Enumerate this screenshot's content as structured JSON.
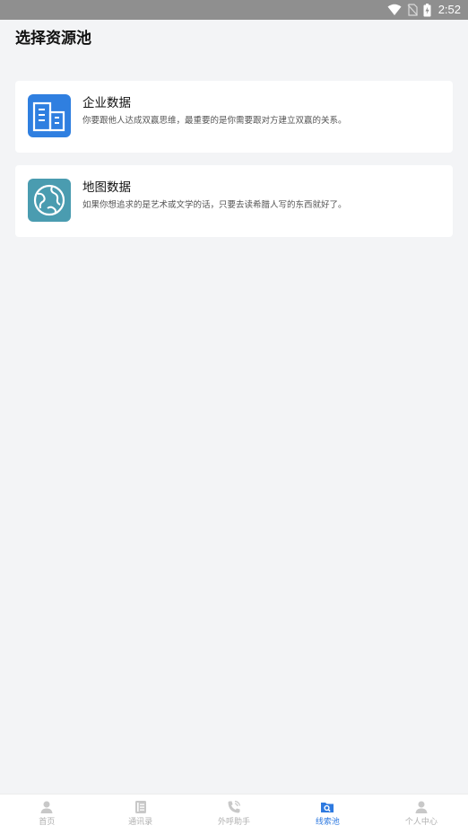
{
  "status_bar": {
    "time": "2:52",
    "icons": [
      "wifi-icon",
      "no-sim-icon",
      "battery-charging-icon"
    ]
  },
  "page": {
    "title": "选择资源池"
  },
  "resource_pools": [
    {
      "title": "企业数据",
      "description": "你要跟他人达成双赢思维，最重要的是你需要跟对方建立双赢的关系。",
      "icon": "buildings-icon"
    },
    {
      "title": "地图数据",
      "description": "如果你想追求的是艺术或文学的话，只要去读希腊人写的东西就好了。",
      "icon": "globe-icon"
    }
  ],
  "tab_bar": {
    "active_index": 3,
    "items": [
      {
        "label": "首页",
        "icon": "home-icon"
      },
      {
        "label": "通讯录",
        "icon": "contacts-icon"
      },
      {
        "label": "外呼助手",
        "icon": "phone-call-icon"
      },
      {
        "label": "线索池",
        "icon": "lead-pool-icon"
      },
      {
        "label": "个人中心",
        "icon": "profile-icon"
      }
    ]
  },
  "colors": {
    "accent": "#2e7ae0",
    "status_bar": "#8f8f8f",
    "background": "#f3f4f6",
    "tab_inactive": "#b0b0b0",
    "building_icon_bg": "#2f7fe0",
    "globe_icon_bg": "#4a9cb0"
  }
}
